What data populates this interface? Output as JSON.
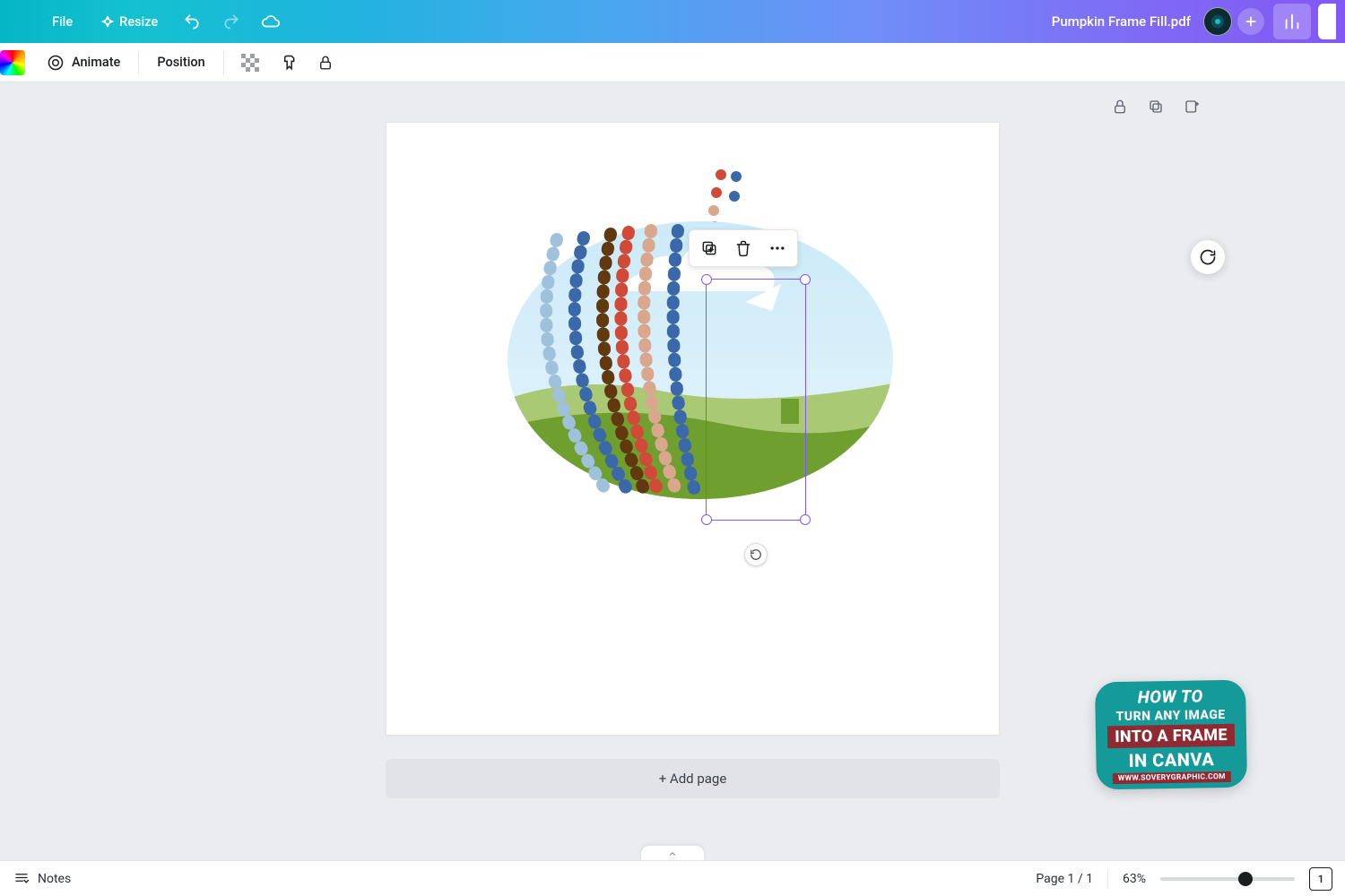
{
  "header": {
    "file_label": "File",
    "resize_label": "Resize",
    "doc_title": "Pumpkin Frame Fill.pdf"
  },
  "toolbar": {
    "animate_label": "Animate",
    "position_label": "Position"
  },
  "context_menu": {
    "duplicate": "Duplicate",
    "delete": "Delete",
    "more": "More"
  },
  "canvas": {
    "add_page_label": "+ Add page"
  },
  "watermark": {
    "line1": "HOW TO",
    "line2": "TURN ANY IMAGE",
    "line3": "INTO A FRAME",
    "line4": "IN CANVA",
    "url": "WWW.SOVERYGRAPHIC.COM"
  },
  "footer": {
    "notes_label": "Notes",
    "page_indicator": "Page 1 / 1",
    "zoom_label": "63%",
    "zoom_percent": 63,
    "grid_count": "1"
  }
}
